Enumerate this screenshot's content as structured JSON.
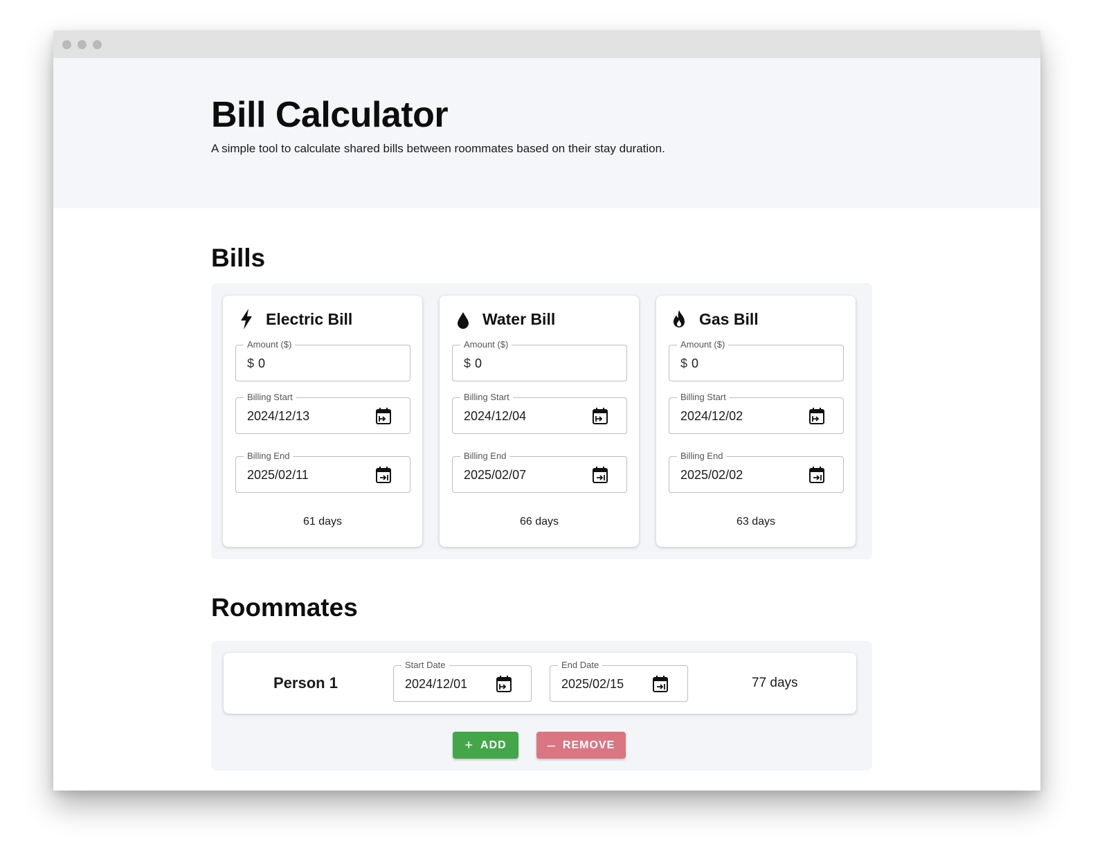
{
  "header": {
    "title": "Bill Calculator",
    "subtitle": "A simple tool to calculate shared bills between roommates based on their stay duration."
  },
  "bills_section": {
    "title": "Bills",
    "bills": [
      {
        "name": "Electric Bill",
        "icon": "lightning-bolt-icon",
        "amount_label": "Amount ($)",
        "currency_prefix": "$",
        "amount": "0",
        "start_label": "Billing Start",
        "start_date": "2024/12/13",
        "end_label": "Billing End",
        "end_date": "2025/02/11",
        "days": "61 days"
      },
      {
        "name": "Water Bill",
        "icon": "water-drop-icon",
        "amount_label": "Amount ($)",
        "currency_prefix": "$",
        "amount": "0",
        "start_label": "Billing Start",
        "start_date": "2024/12/04",
        "end_label": "Billing End",
        "end_date": "2025/02/07",
        "days": "66 days"
      },
      {
        "name": "Gas Bill",
        "icon": "flame-icon",
        "amount_label": "Amount ($)",
        "currency_prefix": "$",
        "amount": "0",
        "start_label": "Billing Start",
        "start_date": "2024/12/02",
        "end_label": "Billing End",
        "end_date": "2025/02/02",
        "days": "63 days"
      }
    ]
  },
  "roommates_section": {
    "title": "Roommates",
    "roommates": [
      {
        "name": "Person 1",
        "start_label": "Start Date",
        "start_date": "2024/12/01",
        "end_label": "End Date",
        "end_date": "2025/02/15",
        "days": "77 days"
      }
    ],
    "add_label": "ADD",
    "remove_label": "REMOVE",
    "add_color": "#43a74a",
    "remove_color": "#d97682"
  }
}
